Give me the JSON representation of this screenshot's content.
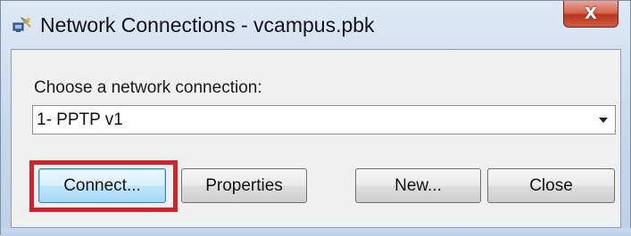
{
  "window": {
    "title": "Network Connections - vcampus.pbk",
    "close_glyph": "X"
  },
  "dialog": {
    "prompt_label": "Choose a network connection:",
    "connection_select": {
      "selected": "1- PPTP v1"
    },
    "buttons": {
      "connect": "Connect...",
      "properties": "Properties",
      "new": "New...",
      "close": "Close"
    }
  },
  "annotation": {
    "highlight_color": "#d2232a"
  }
}
